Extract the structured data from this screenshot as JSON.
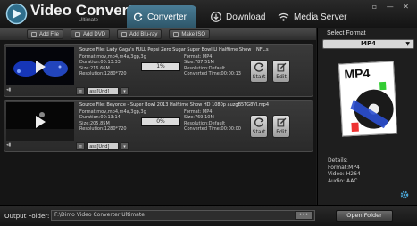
{
  "app": {
    "title": "Video Converter",
    "subtitle": "Ultimate"
  },
  "window_controls": "▫ — ✕",
  "tabs": [
    {
      "label": "Converter",
      "icon": "refresh-icon",
      "active": true
    },
    {
      "label": "Download",
      "icon": "download-icon",
      "active": false
    },
    {
      "label": "Media Server",
      "icon": "wifi-icon",
      "active": false
    }
  ],
  "toolbar": {
    "add_file": "Add File",
    "add_dvd": "Add DVD",
    "add_bluray": "Add Blu-ray",
    "make_iso": "Make ISO"
  },
  "files": [
    {
      "source": "Source File: Lady Gaga's FULL Pepsi Zero Sugar Super Bowl LI Halftime Show _ NFL.s",
      "format": "Format:mov,mp4,m4a,3gp,3g",
      "duration": "Duration:00:13:33",
      "size": "Size:216.66M",
      "resolution": "Resolution:1280*720",
      "progress": "1%",
      "out_format": "Format: MP4",
      "out_size": "Size:787.51M",
      "out_resolution": "Resolution:Default",
      "converted_time": "Converted Time:00:00:13",
      "subtitle": "ass[Und]",
      "start_label": "Start",
      "edit_label": "Edit"
    },
    {
      "source": "Source File: Beyonce - Super Bowl 2013 Halftime Show HD 1080p auzgB5TG8VI.mp4",
      "format": "Format:mov,mp4,m4a,3gp,3g",
      "duration": "Duration:00:13:14",
      "size": "Size:205.85M",
      "resolution": "Resolution:1280*720",
      "progress": "0%",
      "out_format": "Format: MP4",
      "out_size": "Size:769.10M",
      "out_resolution": "Resolution:Default",
      "converted_time": "Converted Time:00:00:00",
      "subtitle": "ass[Und]",
      "start_label": "Start",
      "edit_label": "Edit"
    }
  ],
  "right_panel": {
    "select_format_label": "Select Format",
    "selected_format": "MP4",
    "format_image_label": "MP4",
    "details_title": "Details:",
    "details_format": "Format:MP4",
    "details_video": "Video: H264",
    "details_audio": "Audio: AAC"
  },
  "bottom": {
    "output_folder_label": "Output Folder:",
    "output_path": "F:\\Dimo Video Converter Ultimate",
    "browse_label": "•••",
    "open_folder": "Open Folder"
  },
  "colors": {
    "accent": "#3b6f88",
    "background": "#1b1b1b"
  }
}
